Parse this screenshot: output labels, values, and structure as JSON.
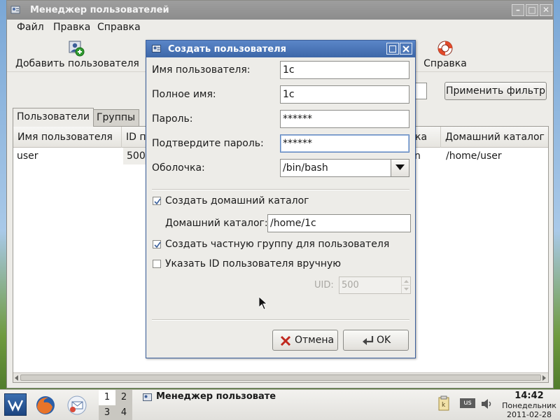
{
  "main_window": {
    "title": "Менеджер пользователей",
    "controls": [
      "–",
      "□",
      "✕"
    ],
    "menu": [
      "Файл",
      "Правка",
      "Справка"
    ],
    "toolbar": {
      "add_user": "Добавить пользователя",
      "help": "Справка"
    },
    "apply_filter": "Применить фильтр",
    "tabs": [
      "Пользователи",
      "Группы"
    ],
    "columns": [
      "Имя пользователя",
      "ID п",
      "ка",
      "Домашний каталог"
    ],
    "rows": [
      {
        "username": "user",
        "id": "500",
        "shell_tail": "n",
        "home": "/home/user"
      }
    ]
  },
  "dialog": {
    "title": "Создать пользователя",
    "username_label": "Имя пользователя:",
    "username_value": "1c",
    "fullname_label": "Полное имя:",
    "fullname_value": "1c",
    "password_label": "Пароль:",
    "password_value": "******",
    "confirm_label": "Подтвердите пароль:",
    "confirm_value": "******",
    "shell_label": "Оболочка:",
    "shell_value": "/bin/bash",
    "create_home_label": "Создать домашний каталог",
    "create_home_checked": true,
    "home_dir_label": "Домашний каталог:",
    "home_dir_value": "/home/1c",
    "private_group_label": "Создать частную группу для пользователя",
    "private_group_checked": true,
    "manual_uid_label": "Указать ID пользователя вручную",
    "manual_uid_checked": false,
    "uid_label": "UID:",
    "uid_value": "500",
    "cancel": "Отмена",
    "ok": "OK"
  },
  "taskbar": {
    "pager": [
      "1",
      "2",
      "3",
      "4"
    ],
    "task_title": "Менеджер пользовате",
    "keyboard_layout": "us",
    "time": "14:42",
    "day": "Понедельник",
    "date": "2011-02-28"
  }
}
